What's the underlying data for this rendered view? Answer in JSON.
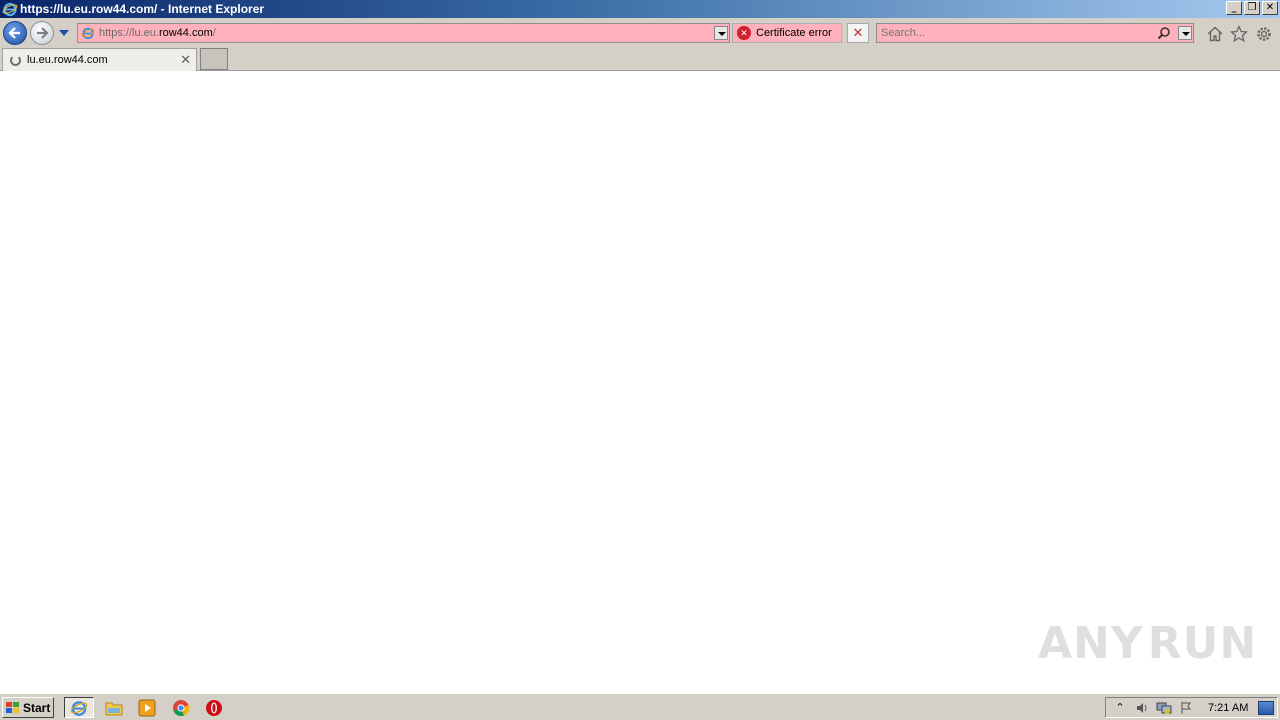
{
  "window": {
    "title": "https://lu.eu.row44.com/ - Internet Explorer",
    "minimize_label": "_",
    "restore_label": "❐",
    "close_label": "✕"
  },
  "navbar": {
    "address_prefix": "https://lu.eu.",
    "address_host": "row44.com",
    "address_suffix": "/",
    "cert_error_label": "Certificate error",
    "stop_label": "✕",
    "search_placeholder": "Search..."
  },
  "tabs": [
    {
      "label": "lu.eu.row44.com",
      "close": "✕"
    }
  ],
  "watermark": {
    "left": "ANY",
    "right": "RUN"
  },
  "taskbar": {
    "start_label": "Start",
    "clock": "7:21 AM"
  },
  "colors": {
    "error_pink": "#ffb2bc",
    "chrome_gray": "#d4d0c8",
    "title_blue": "#0a246a"
  }
}
